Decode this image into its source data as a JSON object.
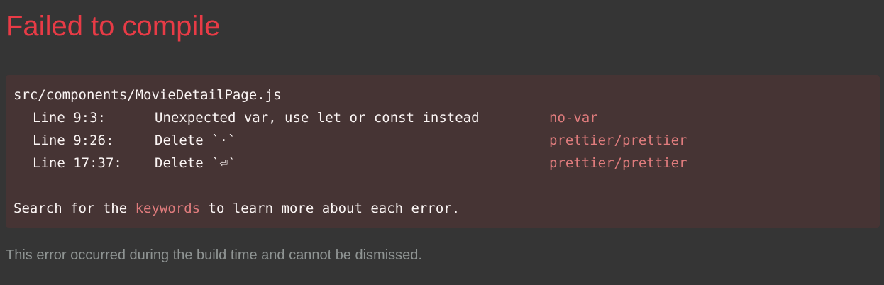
{
  "title": "Failed to compile",
  "error": {
    "file": "src/components/MovieDetailPage.js",
    "lines": [
      {
        "location": "Line 9:3:",
        "message": "Unexpected var, use let or const instead",
        "rule": "no-var"
      },
      {
        "location": "Line 9:26:",
        "message": "Delete `·`",
        "rule": "prettier/prettier"
      },
      {
        "location": "Line 17:37:",
        "message": "Delete `⏎`",
        "rule": "prettier/prettier"
      }
    ],
    "hint_before": "Search for the ",
    "hint_keyword": "keywords",
    "hint_after": " to learn more about each error."
  },
  "footer": "This error occurred during the build time and cannot be dismissed.",
  "colors": {
    "background": "#353535",
    "title": "#e83b46",
    "box_background": "#463434",
    "text": "#fbf5f4",
    "rule": "#e07c7d",
    "footer": "#8f9493"
  }
}
